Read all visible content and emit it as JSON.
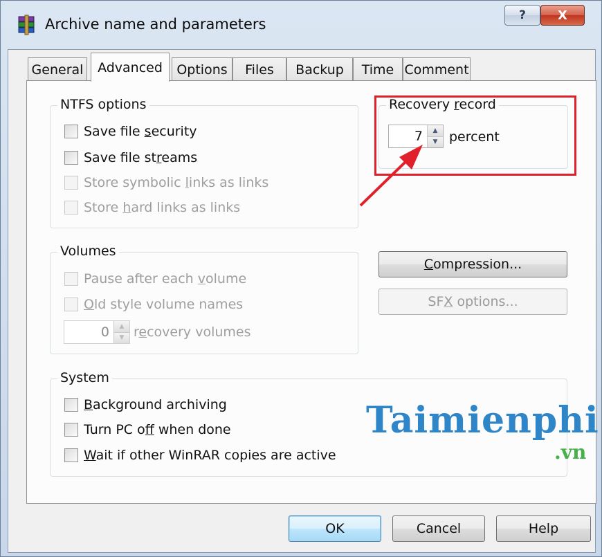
{
  "window": {
    "title": "Archive name and parameters",
    "help_label": "?",
    "close_label": "X"
  },
  "tabs": [
    {
      "label": "General"
    },
    {
      "label": "Advanced",
      "active": true
    },
    {
      "label": "Options"
    },
    {
      "label": "Files"
    },
    {
      "label": "Backup"
    },
    {
      "label": "Time"
    },
    {
      "label": "Comment"
    }
  ],
  "ntfs": {
    "title": "NTFS options",
    "items": [
      {
        "pre": "Save file ",
        "key": "s",
        "post": "ecurity",
        "checked": false,
        "enabled": true
      },
      {
        "pre": "Save file st",
        "key": "r",
        "post": "eams",
        "checked": false,
        "enabled": true
      },
      {
        "pre": "Store symbolic ",
        "key": "l",
        "post": "inks as links",
        "checked": false,
        "enabled": false
      },
      {
        "pre": "Store ",
        "key": "h",
        "post": "ard links as links",
        "checked": false,
        "enabled": false
      }
    ]
  },
  "recovery": {
    "title_pre": "Recovery ",
    "title_key": "r",
    "title_post": "ecord",
    "value": "7",
    "unit": "percent"
  },
  "volumes": {
    "title": "Volumes",
    "items": [
      {
        "pre": "Pause after each ",
        "key": "v",
        "post": "olume",
        "checked": false,
        "enabled": false
      },
      {
        "pre": "",
        "key": "O",
        "post": "ld style volume names",
        "checked": false,
        "enabled": false
      }
    ],
    "recovery_volumes_value": "0",
    "recovery_volumes_pre": "r",
    "recovery_volumes_key": "e",
    "recovery_volumes_post": "covery volumes"
  },
  "buttons": {
    "compression_key": "C",
    "compression_rest": "ompression...",
    "sfx_pre": "SF",
    "sfx_key": "X",
    "sfx_post": " options...",
    "ok": "OK",
    "cancel": "Cancel",
    "help": "Help"
  },
  "system": {
    "title": "System",
    "items": [
      {
        "pre": "",
        "key": "B",
        "post": "ackground archiving",
        "checked": false,
        "enabled": true
      },
      {
        "pre": "Turn PC o",
        "key": "f",
        "post": "f when done",
        "checked": false,
        "enabled": true
      },
      {
        "pre": "",
        "key": "W",
        "post": "ait if other WinRAR copies are active",
        "checked": false,
        "enabled": true
      }
    ]
  },
  "watermark": {
    "brand": "Taimienphi",
    "domain": ".vn"
  },
  "colors": {
    "highlight": "#e0202a",
    "arrow": "#e0202a",
    "watermark_main": "#2e86c8",
    "watermark_domain": "#46b04a"
  }
}
